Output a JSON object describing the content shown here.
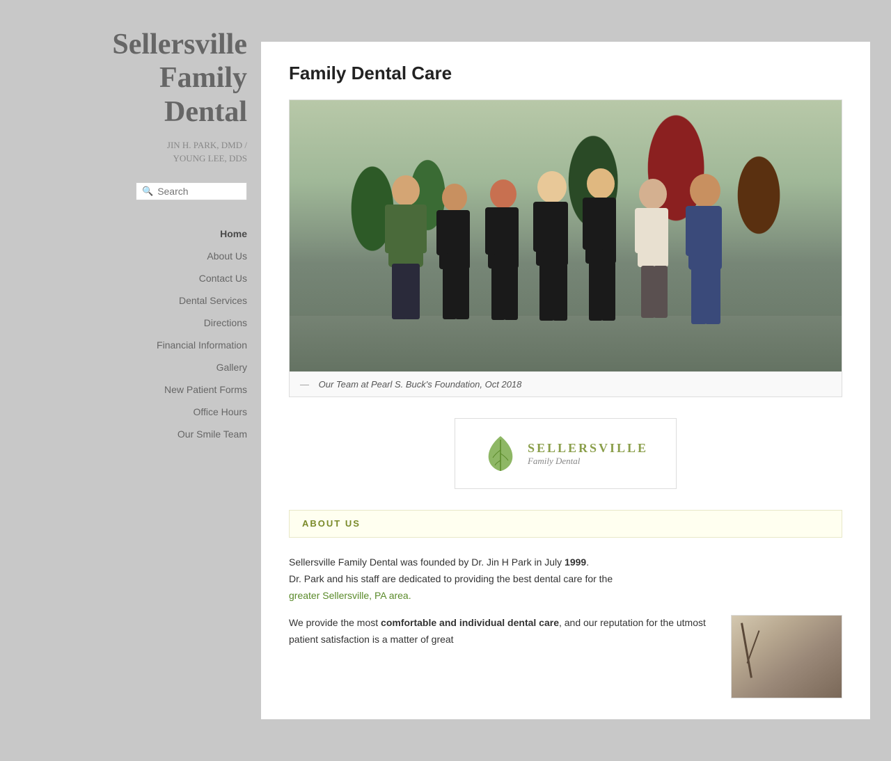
{
  "site": {
    "title_line1": "Sellersville",
    "title_line2": "Family",
    "title_line3": "Dental",
    "subtitle_line1": "JIN H. PARK, DMD /",
    "subtitle_line2": "YOUNG LEE, DDS"
  },
  "search": {
    "placeholder": "Search"
  },
  "nav": {
    "items": [
      {
        "label": "Home",
        "active": true
      },
      {
        "label": "About Us",
        "active": false
      },
      {
        "label": "Contact Us",
        "active": false
      },
      {
        "label": "Dental Services",
        "active": false
      },
      {
        "label": "Directions",
        "active": false
      },
      {
        "label": "Financial Information",
        "active": false
      },
      {
        "label": "Gallery",
        "active": false
      },
      {
        "label": "New Patient Forms",
        "active": false
      },
      {
        "label": "Office Hours",
        "active": false
      },
      {
        "label": "Our Smile Team",
        "active": false
      }
    ]
  },
  "main": {
    "page_title": "Family Dental Care",
    "photo_caption": "Our Team at Pearl S. Buck's Foundation, Oct 2018",
    "caption_dash": "—",
    "logo": {
      "name_line1": "SELLERSVILLE",
      "name_line2": "Family Dental"
    },
    "about_banner": "ABOUT US",
    "body_para1_before": "Sellersville Family Dental was founded by Dr. Jin H Park in July ",
    "body_para1_year": "1999",
    "body_para1_after": ".\nDr. Park and his staff are dedicated to providing the best dental care for the",
    "body_link": "greater Sellersville, PA area.",
    "body_para2_before": "We provide the most ",
    "body_para2_bold": "comfortable and individual dental care",
    "body_para2_after": ", and our reputation for the utmost patient satisfaction is a matter of great"
  }
}
